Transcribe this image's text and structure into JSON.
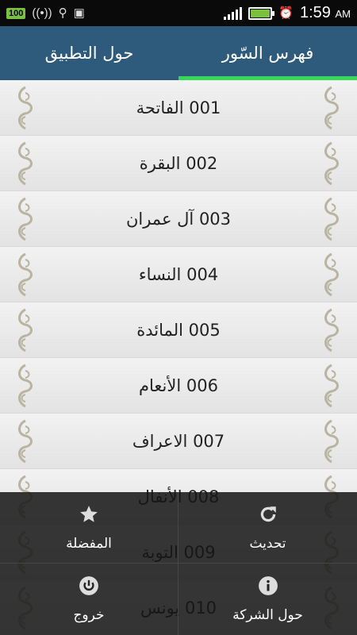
{
  "status_bar": {
    "battery_percent": "100",
    "time": "1:59",
    "ampm": "AM"
  },
  "tabs": [
    {
      "label": "حول التطبيق",
      "active": false
    },
    {
      "label": "فهرس السّور",
      "active": true
    }
  ],
  "surahs": [
    {
      "label": "001 الفاتحة"
    },
    {
      "label": "002 البقرة"
    },
    {
      "label": "003 آل عمران"
    },
    {
      "label": "004 النساء"
    },
    {
      "label": "005 المائدة"
    },
    {
      "label": "006 الأنعام"
    },
    {
      "label": "007 الاعراف"
    },
    {
      "label": "008 الأنفال"
    },
    {
      "label": "009 التوبة"
    },
    {
      "label": "010 يونس"
    }
  ],
  "menu": {
    "favorites": "المفضلة",
    "refresh": "تحديث",
    "exit": "خروج",
    "about_company": "حول الشركة"
  },
  "colors": {
    "tab_bar": "#2e5a7c",
    "tab_indicator": "#37d85a",
    "ornament": "#b9b4a0"
  }
}
